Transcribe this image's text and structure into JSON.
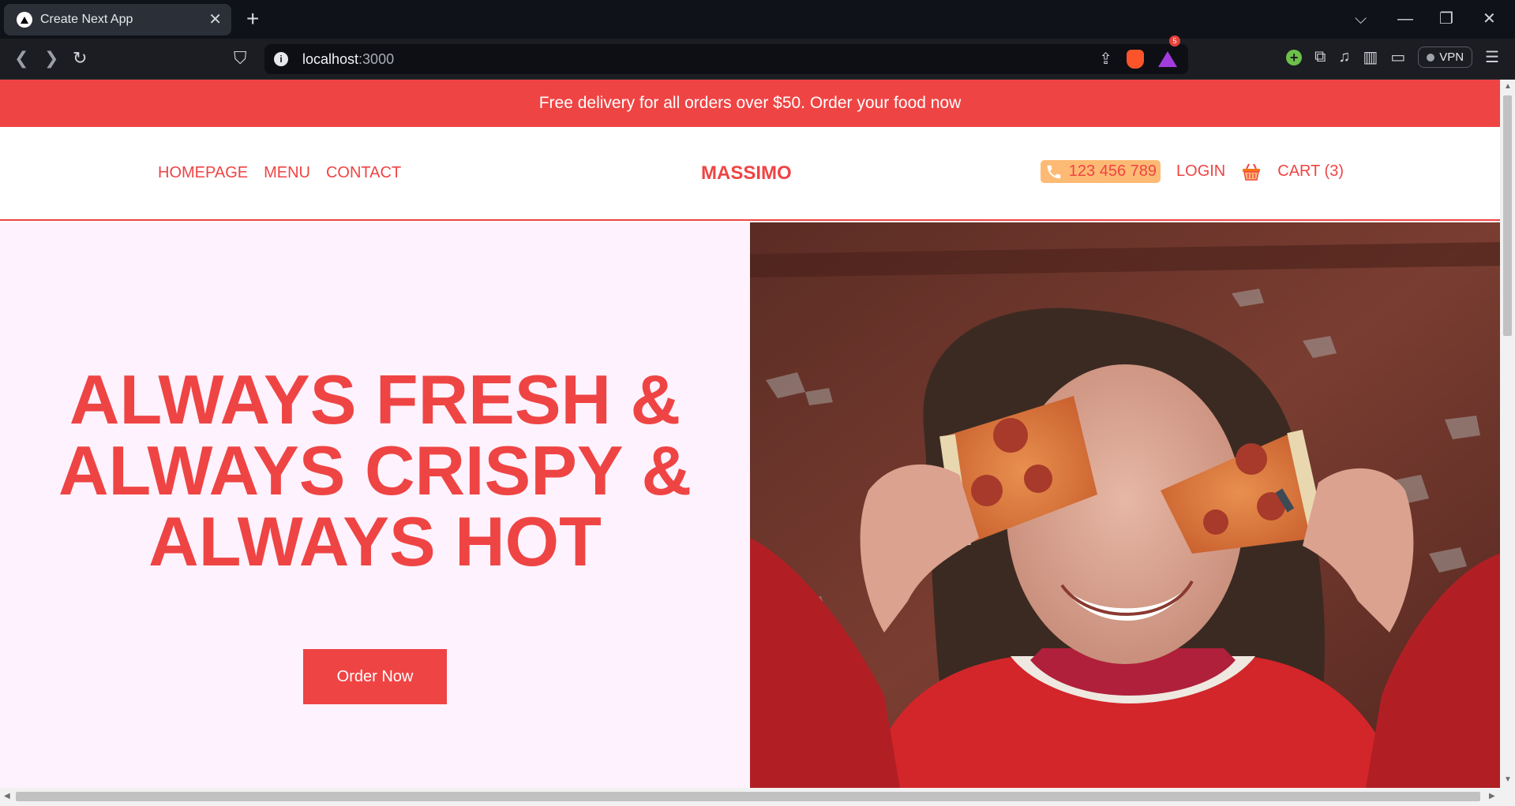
{
  "browser": {
    "tab_title": "Create Next App",
    "url_host": "localhost",
    "url_port": ":3000",
    "rewards_count": "5",
    "vpn_label": "VPN"
  },
  "promo": {
    "text": "Free delivery for all orders over $50. Order your food now"
  },
  "nav": {
    "links": [
      "HOMEPAGE",
      "MENU",
      "CONTACT"
    ],
    "logo": "MASSIMO",
    "phone": "123 456 789",
    "login": "LOGIN",
    "cart": "CART (3)"
  },
  "hero": {
    "headline_lines": [
      "ALWAYS FRESH &",
      "ALWAYS CRISPY &",
      "ALWAYS HOT"
    ],
    "cta": "Order Now"
  },
  "colors": {
    "brand": "#ef4444",
    "hero_bg": "#fdf2fd",
    "phone_bg": "#fdba74"
  }
}
